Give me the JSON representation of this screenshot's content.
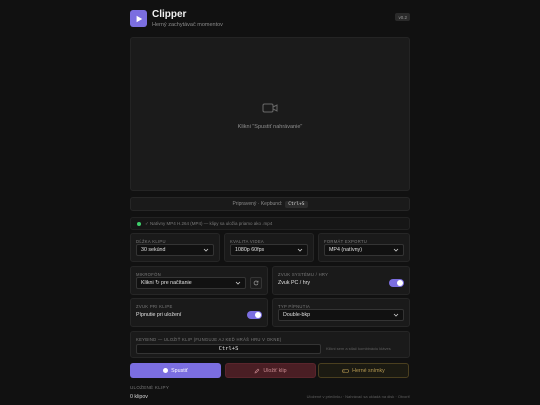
{
  "app": {
    "title": "Clipper",
    "subtitle": "Herný zachytávač momentov",
    "version": "v0.2"
  },
  "preview": {
    "text": "Klikni \"Spustiť nahrávanie\""
  },
  "status": {
    "text": "Pripravený · Kepbund:",
    "key": "Ctrl+S"
  },
  "info": {
    "text": "✓ Natívny MP4 H.264 (MP4) — klipy sa uložia priamo ako .mp4"
  },
  "clip_length": {
    "label": "DĹŽKA KLIPU",
    "value": "30 sekúnd"
  },
  "quality": {
    "label": "KVALITA VIDEA",
    "value": "1080p 60fps"
  },
  "format": {
    "label": "FORMÁT EXPORTU",
    "value": "MP4 (natívny)"
  },
  "microphone": {
    "label": "MIKROFÓN",
    "value": "Klikni ↻ pre načítanie"
  },
  "system_audio": {
    "label": "ZVUK SYSTÉMU / HRY",
    "value": "Zvuk PC / hry",
    "enabled": true
  },
  "save_sound": {
    "label": "ZVUK PRI KLIPE",
    "value": "Pípnutie pri uložení",
    "enabled": true
  },
  "notify_type": {
    "label": "TYP PÍPNUTIA",
    "value": "Double-bkp"
  },
  "hotkey": {
    "label": "KEYBIND — ULOŽIŤ KLIP (FUNGUJE AJ KEĎ HRÁŠ HRU V OKNE)",
    "value": "Ctrl+S",
    "hint": "Klikni sem a stlač kombináciu kláves"
  },
  "buttons": {
    "start": "Spustiť",
    "save": "Uložiť klip",
    "games": "Herné snímky"
  },
  "clips": {
    "label": "ULOŽENÉ KLIPY",
    "count": "0 klipov",
    "note": "Uložené v priečinku · Nahrávač sa ukladá na disk · Otvoriť"
  },
  "colors": {
    "accent": "#7b6ee0",
    "danger": "#4a1e24",
    "warning": "#b79a52",
    "ok": "#3ecf6b"
  }
}
